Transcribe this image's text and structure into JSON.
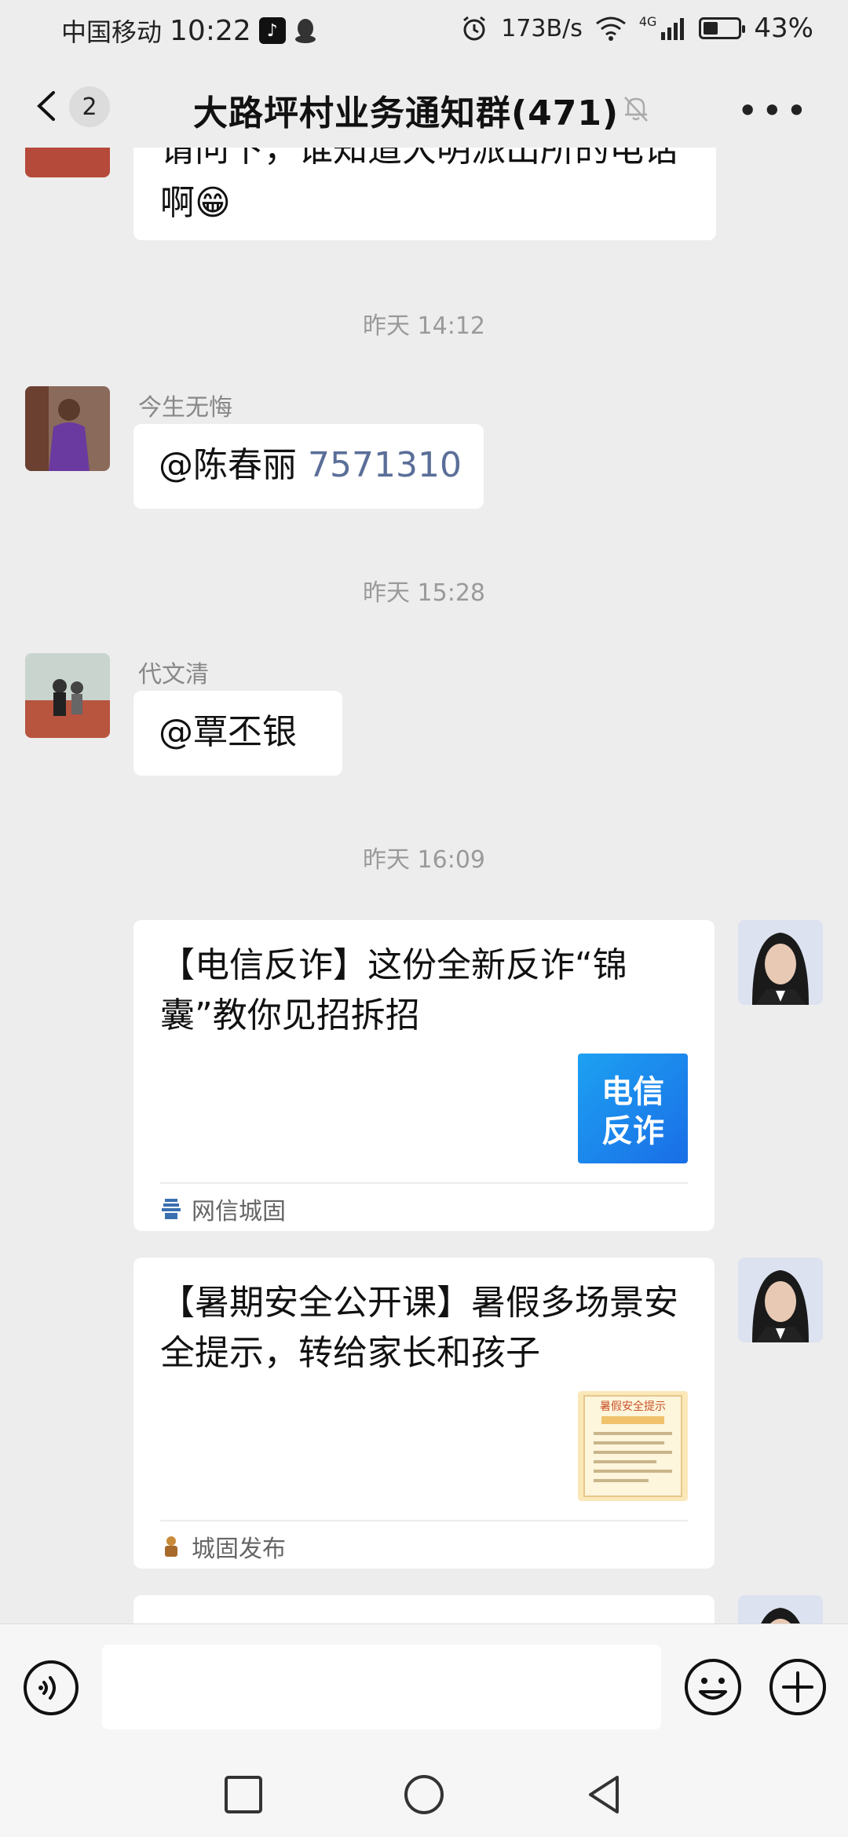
{
  "status_bar": {
    "carrier": "中国移动",
    "time": "10:22",
    "net_speed": "173B/s",
    "network": "4G",
    "battery": "43%",
    "battery_level": 0.43
  },
  "nav": {
    "back_badge": "2",
    "title": "大路坪村业务通知群(471)"
  },
  "messages": {
    "partial_top": {
      "line1": "请问下，谁知道大明派出所的电话",
      "line2": "啊😁"
    },
    "ts1": "昨天 14:12",
    "msg1": {
      "sender": "今生无悔",
      "text": "@陈春丽 ",
      "number": "7571310"
    },
    "ts2": "昨天 15:28",
    "msg2": {
      "sender": "代文清",
      "text": "@覃丕银"
    },
    "ts3": "昨天 16:09",
    "card1": {
      "title": "【电信反诈】这份全新反诈“锦囊”教你见招拆招",
      "thumb_text": "电信\n反诈",
      "thumb_line1": "电信",
      "thumb_line2": "反诈",
      "source": "网信城固"
    },
    "card2": {
      "title": "【暑期安全公开课】暑假多场景安全提示，转给家长和孩子",
      "thumb_title": "暑假安全提示",
      "source": "城固发布"
    }
  },
  "input": {
    "placeholder": ""
  },
  "colors": {
    "bg": "#ededed",
    "bubble": "#ffffff",
    "mention": "#5a6e98",
    "timestamp": "#9a9a9a"
  }
}
